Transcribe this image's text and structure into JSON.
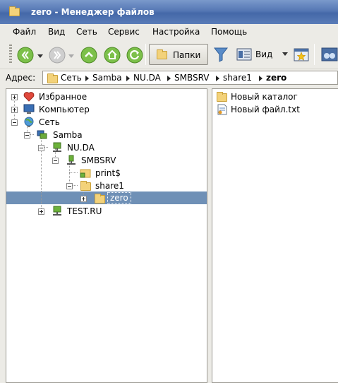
{
  "window": {
    "title": "zero - Менеджер файлов"
  },
  "menu": [
    "Файл",
    "Вид",
    "Сеть",
    "Сервис",
    "Настройка",
    "Помощь"
  ],
  "toolbar": {
    "folders_label": "Папки",
    "view_label": "Вид"
  },
  "address": {
    "label": "Адрес:",
    "crumbs": [
      "Сеть",
      "Samba",
      "NU.DA",
      "SMBSRV",
      "share1",
      "zero"
    ]
  },
  "tree": [
    {
      "label": "Избранное",
      "icon": "heart-icon"
    },
    {
      "label": "Компьютер",
      "icon": "computer-icon"
    },
    {
      "label": "Сеть",
      "icon": "globe-icon"
    },
    {
      "label": "Samba",
      "icon": "network-icon"
    },
    {
      "label": "NU.DA",
      "icon": "workgroup-icon"
    },
    {
      "label": "SMBSRV",
      "icon": "server-icon"
    },
    {
      "label": "print$",
      "icon": "shared-folder-icon"
    },
    {
      "label": "share1",
      "icon": "folder-icon"
    },
    {
      "label": "zero",
      "icon": "folder-icon",
      "selected": true
    },
    {
      "label": "TEST.RU",
      "icon": "workgroup-icon"
    }
  ],
  "files": [
    {
      "label": "Новый каталог",
      "icon": "folder-icon"
    },
    {
      "label": "Новый файл.txt",
      "icon": "text-file-icon"
    }
  ],
  "colors": {
    "titlebar": "#5577b4",
    "selection": "#6f90b6",
    "folder": "#f3d27a",
    "green": "#6cb23a"
  }
}
